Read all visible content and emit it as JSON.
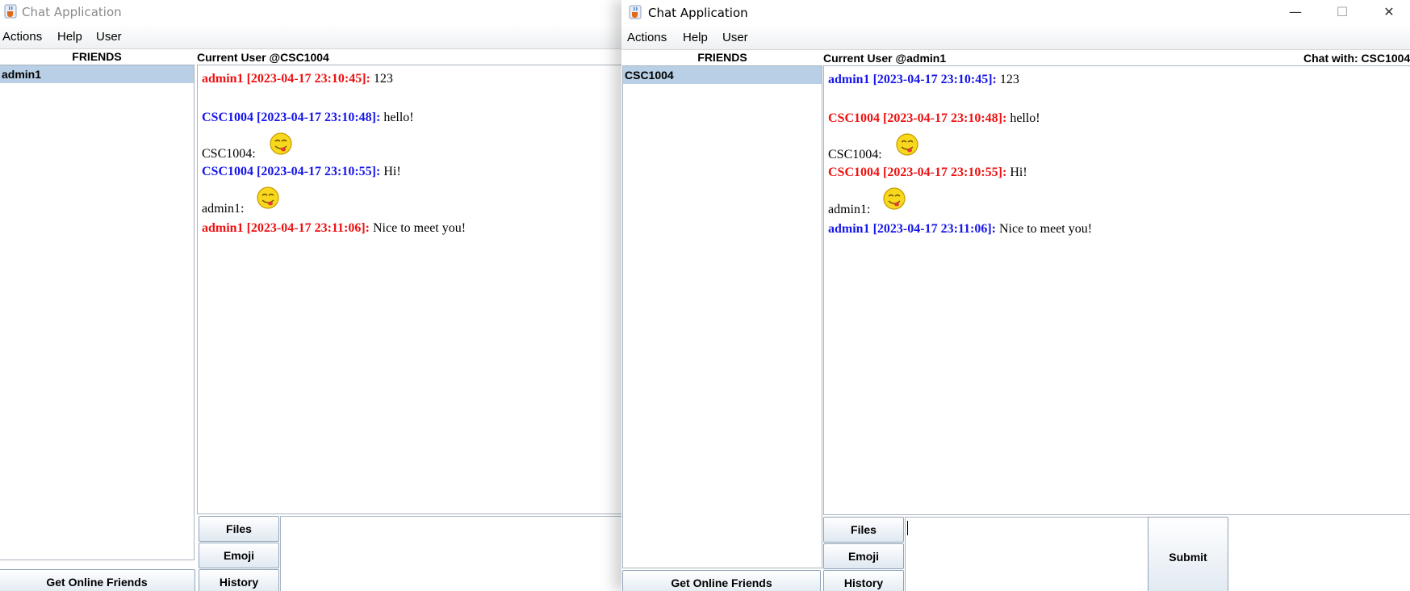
{
  "left_window": {
    "title": "Chat Application",
    "menu": [
      "Actions",
      "Help",
      "User"
    ],
    "friends_header": "FRIENDS",
    "friends": [
      "admin1"
    ],
    "current_user": "Current User @CSC1004",
    "messages": [
      {
        "sender": "admin1",
        "time": "[2023-04-17 23:10:45]:",
        "text": "123",
        "color": "#ee1111"
      },
      {
        "sender": "CSC1004",
        "time": "[2023-04-17 23:10:48]:",
        "text": "hello!",
        "color": "#1616e8"
      },
      {
        "emoji_from": "CSC1004:"
      },
      {
        "sender": "CSC1004",
        "time": "[2023-04-17 23:10:55]:",
        "text": "Hi!",
        "color": "#1616e8"
      },
      {
        "emoji_from": "admin1:"
      },
      {
        "sender": "admin1",
        "time": "[2023-04-17 23:11:06]:",
        "text": "Nice to meet you!",
        "color": "#ee1111"
      }
    ],
    "buttons": {
      "files": "Files",
      "emoji": "Emoji",
      "history": "History",
      "get_online_friends": "Get Online Friends"
    }
  },
  "right_window": {
    "title": "Chat Application",
    "window_controls": {
      "minimize": "—",
      "maximize": "☐",
      "close": "✕"
    },
    "menu": [
      "Actions",
      "Help",
      "User"
    ],
    "friends_header": "FRIENDS",
    "friends": [
      "CSC1004"
    ],
    "current_user": "Current User @admin1",
    "chat_with": "Chat with: CSC1004",
    "messages": [
      {
        "sender": "admin1",
        "time": "[2023-04-17 23:10:45]:",
        "text": "123",
        "color": "#1616e8"
      },
      {
        "sender": "CSC1004",
        "time": "[2023-04-17 23:10:48]:",
        "text": "hello!",
        "color": "#ee1111"
      },
      {
        "emoji_from": "CSC1004:"
      },
      {
        "sender": "CSC1004",
        "time": "[2023-04-17 23:10:55]:",
        "text": "Hi!",
        "color": "#ee1111"
      },
      {
        "emoji_from": "admin1:"
      },
      {
        "sender": "admin1",
        "time": "[2023-04-17 23:11:06]:",
        "text": "Nice to meet you!",
        "color": "#1616e8"
      }
    ],
    "buttons": {
      "files": "Files",
      "emoji": "Emoji",
      "history": "History",
      "get_online_friends": "Get Online Friends",
      "submit": "Submit"
    }
  },
  "icons": {
    "app": "java-cup-icon",
    "emoji": "smiley-tongue-icon"
  },
  "colors": {
    "self_sender": "#1616e8",
    "other_sender": "#ee1111",
    "selection": "#b8cfe5"
  }
}
